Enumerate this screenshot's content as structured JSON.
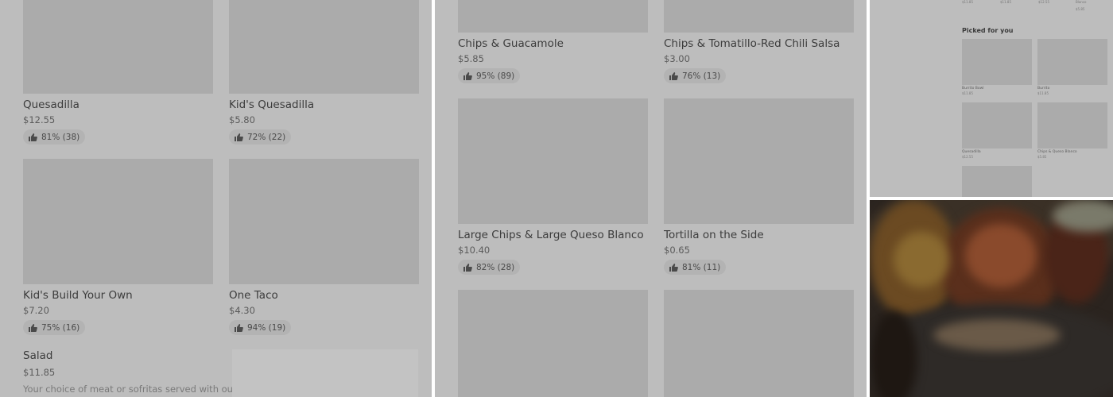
{
  "panel1": {
    "items": [
      {
        "name": "Quesadilla",
        "price": "$12.55",
        "rating": "81% (38)"
      },
      {
        "name": "Kid's Quesadilla",
        "price": "$5.80",
        "rating": "72% (22)"
      },
      {
        "name": "Kid's Build Your Own",
        "price": "$7.20",
        "rating": "75% (16)"
      },
      {
        "name": "One Taco",
        "price": "$4.30",
        "rating": "94% (19)"
      }
    ],
    "salad": {
      "name": "Salad",
      "price": "$11.85",
      "description": "Your choice of meat or sofritas served with our"
    }
  },
  "panel2": {
    "items": [
      {
        "name": "Chips & Guacamole",
        "price": "$5.85",
        "rating": "95% (89)"
      },
      {
        "name": "Chips & Tomatillo-Red Chili Salsa",
        "price": "$3.00",
        "rating": "76% (13)"
      },
      {
        "name": "Large Chips & Large Queso Blanco",
        "price": "$10.40",
        "rating": "82% (28)"
      },
      {
        "name": "Tortilla on the Side",
        "price": "$0.65",
        "rating": "81% (11)"
      }
    ]
  },
  "panel3": {
    "top_prices": [
      "$11.85",
      "$11.85",
      "$12.55"
    ],
    "top_item": {
      "name": "Blanco",
      "price": "$5.85"
    },
    "section_title": "Picked for you",
    "items": [
      {
        "name": "Burrito Bowl",
        "price": "$11.85"
      },
      {
        "name": "Burrito",
        "price": "$11.85"
      },
      {
        "name": "Quesadilla",
        "price": "$12.55"
      },
      {
        "name": "Chips & Queso Blanco",
        "price": "$5.85"
      }
    ]
  },
  "icons": {
    "rating": "thumbs-up-icon"
  },
  "colors": {
    "overlay": "#bdbdbd",
    "placeholder": "#ababab"
  }
}
